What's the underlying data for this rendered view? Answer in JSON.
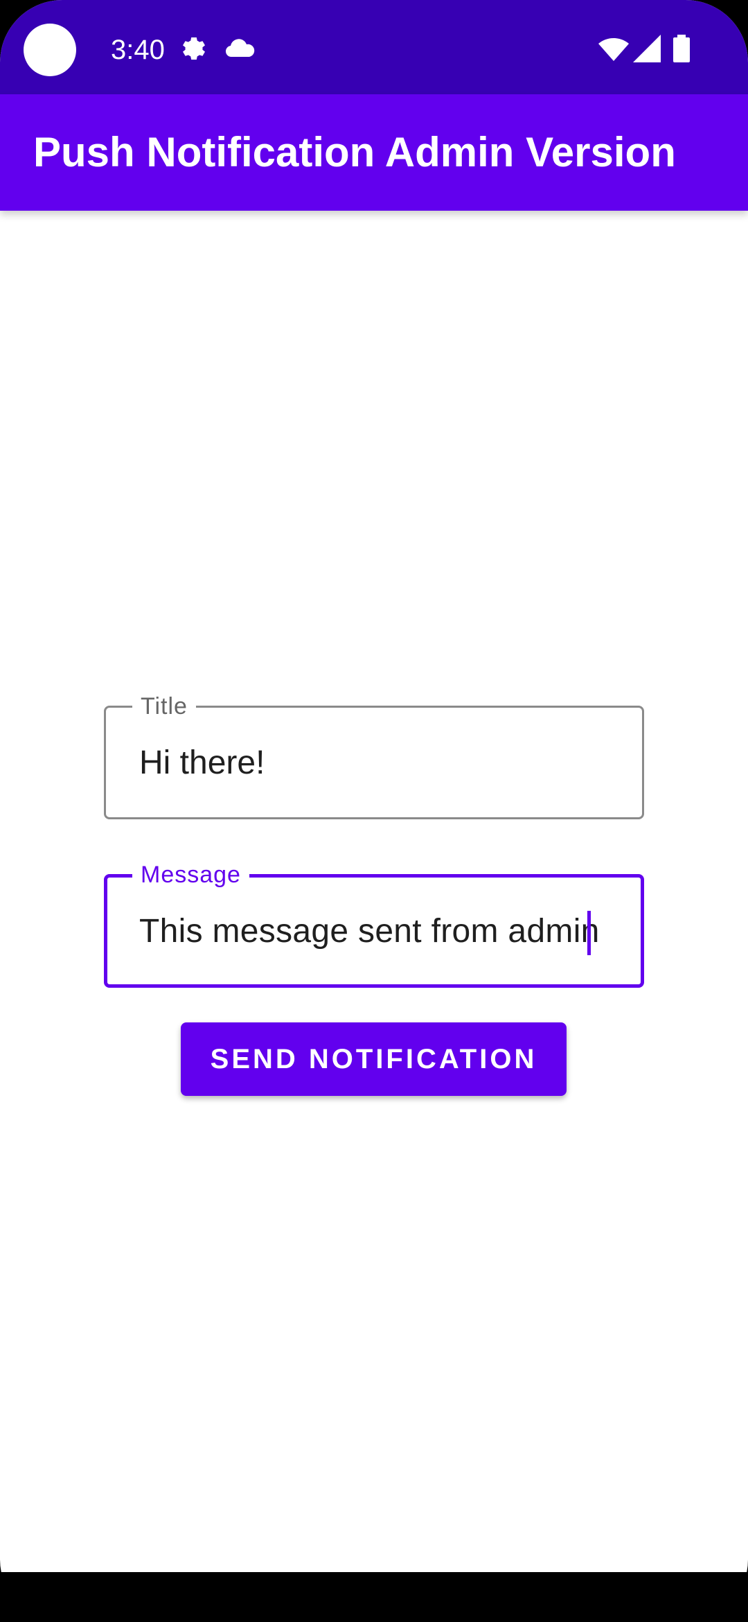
{
  "status_bar": {
    "time": "3:40",
    "icons": [
      "settings-gear-icon",
      "cloud-icon",
      "wifi-icon",
      "cellular-signal-icon",
      "battery-icon"
    ]
  },
  "app_bar": {
    "title": "Push Notification Admin Version"
  },
  "form": {
    "title_field": {
      "label": "Title",
      "value": "Hi there!"
    },
    "message_field": {
      "label": "Message",
      "value": "This message sent from admin",
      "focused": true
    },
    "send_button_label": "SEND NOTIFICATION"
  },
  "colors": {
    "status_bar": "#3700b3",
    "primary": "#6200ee",
    "background": "#ffffff",
    "outline_inactive": "#8a8a8a"
  }
}
